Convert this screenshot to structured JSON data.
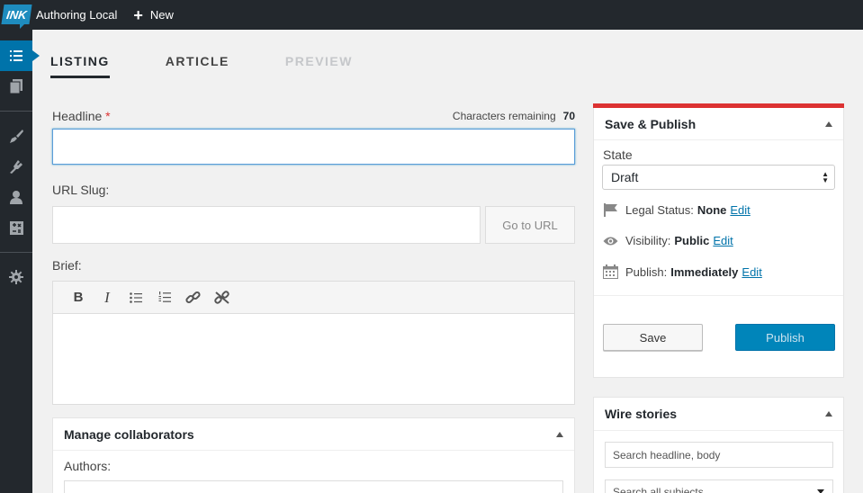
{
  "topbar": {
    "logo_text": "INK",
    "site_name": "Authoring Local",
    "new_label": "New"
  },
  "sidebar": {
    "items": [
      {
        "icon": "list-icon",
        "active": true
      },
      {
        "icon": "pages-icon"
      },
      {
        "icon": "brush-icon"
      },
      {
        "icon": "plugin-icon"
      },
      {
        "icon": "user-icon"
      },
      {
        "icon": "tools-icon"
      },
      {
        "icon": "settings-icon"
      }
    ]
  },
  "tabs": [
    {
      "label": "LISTING",
      "state": "active"
    },
    {
      "label": "ARTICLE",
      "state": "normal"
    },
    {
      "label": "PREVIEW",
      "state": "disabled"
    }
  ],
  "form": {
    "headline_label": "Headline",
    "required_mark": "*",
    "chars_label": "Characters remaining",
    "chars_count": "70",
    "headline_value": "",
    "slug_label": "URL Slug:",
    "slug_value": "",
    "goto_label": "Go to URL",
    "brief_label": "Brief:",
    "editor_tools": [
      "bold-icon",
      "italic-icon",
      "bullet-list-icon",
      "numbered-list-icon",
      "link-icon",
      "unlink-icon"
    ],
    "bold_glyph": "B",
    "italic_glyph": "I"
  },
  "collaborators": {
    "title": "Manage collaborators",
    "authors_label": "Authors:"
  },
  "save_publish": {
    "title": "Save & Publish",
    "state_label": "State",
    "state_value": "Draft",
    "legal_label": "Legal Status:",
    "legal_value": "None",
    "visibility_label": "Visibility:",
    "visibility_value": "Public",
    "publish_label": "Publish:",
    "publish_value": "Immediately",
    "edit_label": "Edit",
    "save_button": "Save",
    "publish_button": "Publish",
    "accent_color": "#dc3232"
  },
  "wire": {
    "title": "Wire stories",
    "search_placeholder": "Search headline, body",
    "subjects_placeholder": "Search all subjects"
  }
}
